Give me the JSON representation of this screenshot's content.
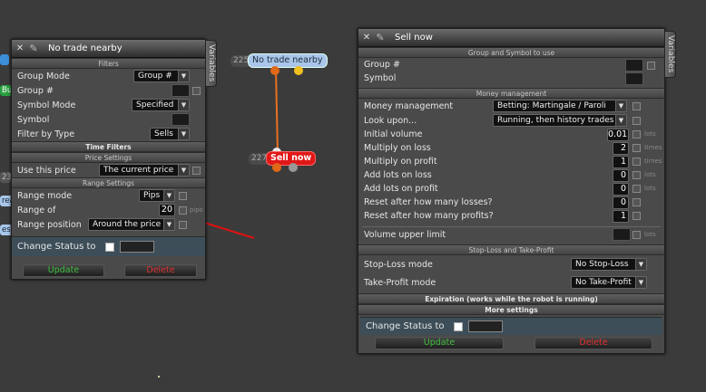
{
  "left_panel": {
    "title": "No trade nearby",
    "variables_tab": "Variables",
    "sections": {
      "filters": "Filters",
      "time_filters": "Time Filters",
      "price_settings": "Price Settings",
      "range_settings": "Range Settings"
    },
    "rows": {
      "group_mode": {
        "label": "Group Mode",
        "value": "Group #"
      },
      "group_num": {
        "label": "Group #"
      },
      "symbol_mode": {
        "label": "Symbol Mode",
        "value": "Specified"
      },
      "symbol": {
        "label": "Symbol"
      },
      "filter_by_type": {
        "label": "Filter by Type",
        "value": "Sells"
      },
      "use_this_price": {
        "label": "Use this price",
        "value": "The current price"
      },
      "range_mode": {
        "label": "Range mode",
        "value": "Pips"
      },
      "range_of": {
        "label": "Range of",
        "value": "20",
        "unit": "pips"
      },
      "range_position": {
        "label": "Range position",
        "value": "Around the price"
      }
    },
    "status": {
      "label": "Change Status to"
    },
    "buttons": {
      "update": "Update",
      "delete": "Delete"
    }
  },
  "right_panel": {
    "title": "Sell now",
    "variables_tab": "Variables",
    "sections": {
      "group_symbol": "Group and Symbol to use",
      "money": "Money management",
      "sltp": "Stop-Loss and Take-Profit",
      "expiration": "Expiration (works while the robot is running)",
      "more": "More settings"
    },
    "rows": {
      "group_num": {
        "label": "Group #"
      },
      "symbol": {
        "label": "Symbol"
      },
      "money_management": {
        "label": "Money management",
        "value": "Betting: Martingale / Paroli"
      },
      "look_upon": {
        "label": "Look upon...",
        "value": "Running, then history trades"
      },
      "initial_volume": {
        "label": "Initial volume",
        "value": "0.01",
        "unit": "lots"
      },
      "multiply_on_loss": {
        "label": "Multiply on loss",
        "value": "2",
        "unit": "times"
      },
      "multiply_on_profit": {
        "label": "Multiply on profit",
        "value": "1",
        "unit": "times"
      },
      "add_lots_on_loss": {
        "label": "Add lots on loss",
        "value": "0",
        "unit": "lots"
      },
      "add_lots_on_profit": {
        "label": "Add lots on profit",
        "value": "0",
        "unit": "lots"
      },
      "reset_losses": {
        "label": "Reset after how many losses?",
        "value": "0"
      },
      "reset_profits": {
        "label": "Reset after how many profits?",
        "value": "1"
      },
      "volume_upper_limit": {
        "label": "Volume upper limit",
        "unit": "lots"
      },
      "stop_loss_mode": {
        "label": "Stop-Loss mode",
        "value": "No Stop-Loss"
      },
      "take_profit_mode": {
        "label": "Take-Profit mode",
        "value": "No Take-Profit"
      }
    },
    "status": {
      "label": "Change Status to"
    },
    "buttons": {
      "update": "Update",
      "delete": "Delete"
    }
  },
  "canvas": {
    "node_top": {
      "id": "225",
      "label": "No trade nearby"
    },
    "node_bottom": {
      "id": "227",
      "label": "Sell now"
    },
    "side_tags": [
      "Bu",
      "23",
      "rea",
      "es"
    ],
    "colors": {
      "arrow": "#e01010",
      "connector": "#e87020",
      "node_top_bg": "#a9c6ea",
      "node_bottom_bg": "#e01818"
    }
  }
}
